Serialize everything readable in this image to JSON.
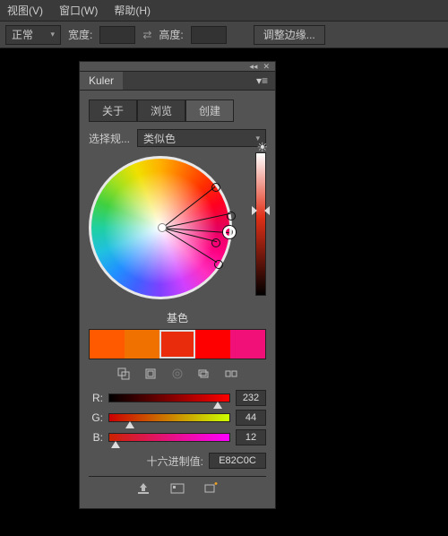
{
  "menu": {
    "view": "视图(V)",
    "window": "窗口(W)",
    "help": "帮助(H)"
  },
  "toolbar": {
    "mode": "正常",
    "width_label": "宽度:",
    "height_label": "高度:",
    "refine_edges": "调整边缘..."
  },
  "panel": {
    "title": "Kuler",
    "tabs": {
      "about": "关于",
      "browse": "浏览",
      "create": "创建"
    },
    "rule_label": "选择规...",
    "rule_value": "类似色",
    "base_label": "基色",
    "hex_label": "十六进制值:",
    "hex_value": "E82C0C"
  },
  "swatches": [
    {
      "color": "#FF5A00"
    },
    {
      "color": "#F07000"
    },
    {
      "color": "#E82C0C",
      "selected": true
    },
    {
      "color": "#FF0000"
    },
    {
      "color": "#F01078"
    }
  ],
  "sliders": {
    "r": {
      "label": "R:",
      "value": "232",
      "knob_pct": 90
    },
    "g": {
      "label": "G:",
      "value": "44",
      "knob_pct": 17
    },
    "b": {
      "label": "B:",
      "value": "12",
      "knob_pct": 5
    }
  }
}
